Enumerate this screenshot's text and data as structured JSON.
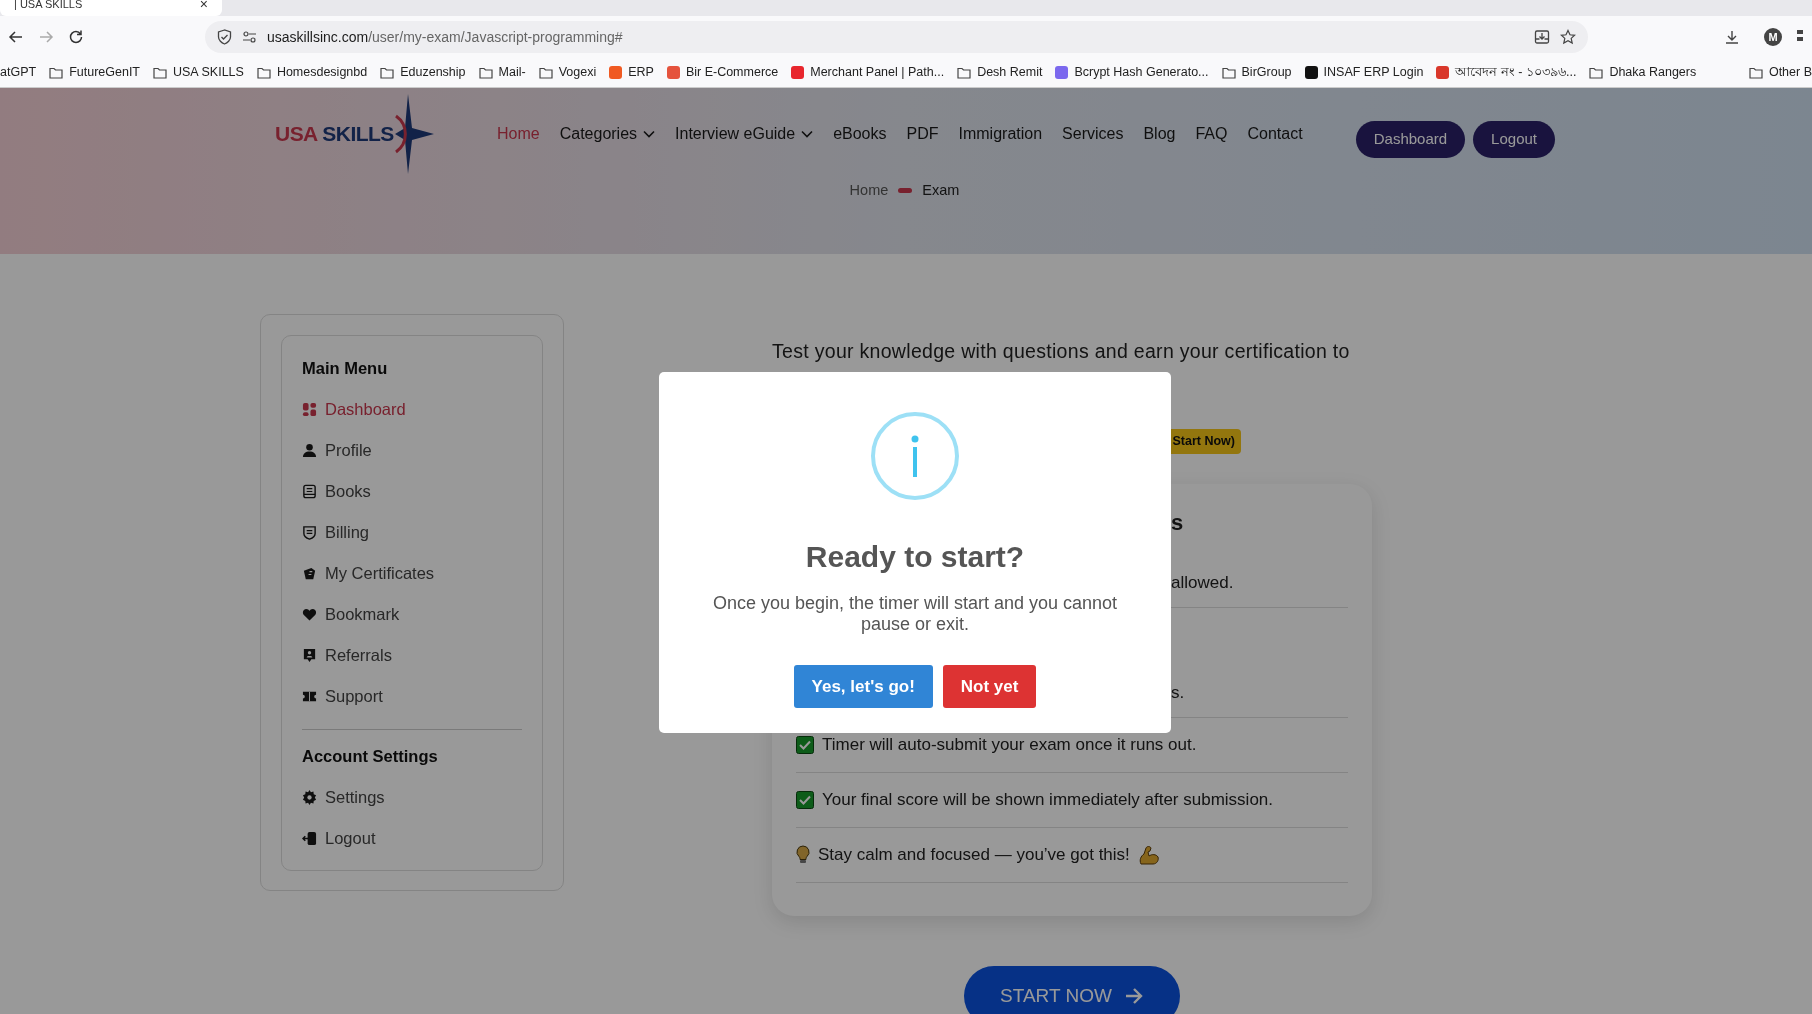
{
  "browser": {
    "tab": {
      "title": "| USA SKILLS",
      "close": "×"
    },
    "address": {
      "domain": "usaskillsinc.com",
      "path": "/user/my-exam/Javascript-programming#"
    },
    "profile": "M",
    "bookmarks": [
      {
        "label": "atGPT",
        "kind": "none"
      },
      {
        "label": "FutureGenIT",
        "kind": "folder"
      },
      {
        "label": "USA SKILLS",
        "kind": "folder"
      },
      {
        "label": "Homesdesignbd",
        "kind": "folder"
      },
      {
        "label": "Eduzenship",
        "kind": "folder"
      },
      {
        "label": "Mail-",
        "kind": "folder"
      },
      {
        "label": "Vogexi",
        "kind": "folder"
      },
      {
        "label": "ERP",
        "kind": "site",
        "color": "#f05a22"
      },
      {
        "label": "Bir E-Commerce",
        "kind": "site",
        "color": "#e5533d"
      },
      {
        "label": "Merchant Panel | Path...",
        "kind": "site",
        "color": "#e8262d"
      },
      {
        "label": "Desh Remit",
        "kind": "folder"
      },
      {
        "label": "Bcrypt Hash Generato...",
        "kind": "site",
        "color": "#7b68ee"
      },
      {
        "label": "BirGroup",
        "kind": "folder"
      },
      {
        "label": "INSAF ERP Login",
        "kind": "site",
        "color": "#111111"
      },
      {
        "label": "আবেদন নং - ১০৩৯৬...",
        "kind": "site",
        "color": "#d9372b"
      },
      {
        "label": "Dhaka Rangers",
        "kind": "folder"
      },
      {
        "label": "Other B",
        "kind": "folder"
      }
    ]
  },
  "header": {
    "logo": [
      "USA",
      "SKILLS"
    ],
    "nav": [
      {
        "label": "Home",
        "selected": true,
        "kind": "link"
      },
      {
        "label": "Categories",
        "selected": false,
        "kind": "dropdown"
      },
      {
        "label": "Interview eGuide",
        "selected": false,
        "kind": "dropdown"
      },
      {
        "label": "eBooks",
        "selected": false,
        "kind": "link"
      },
      {
        "label": "PDF",
        "selected": false,
        "kind": "link"
      },
      {
        "label": "Immigration",
        "selected": false,
        "kind": "link"
      },
      {
        "label": "Services",
        "selected": false,
        "kind": "link"
      },
      {
        "label": "Blog",
        "selected": false,
        "kind": "link"
      },
      {
        "label": "FAQ",
        "selected": false,
        "kind": "link"
      },
      {
        "label": "Contact",
        "selected": false,
        "kind": "link"
      }
    ],
    "buttons": [
      "Dashboard",
      "Logout"
    ],
    "breadcrumb": [
      "Home",
      "Exam"
    ]
  },
  "sidebar": {
    "sections": [
      {
        "title": "Main Menu",
        "items": [
          {
            "label": "Dashboard",
            "selected": true
          },
          {
            "label": "Profile",
            "selected": false
          },
          {
            "label": "Books",
            "selected": false
          },
          {
            "label": "Billing",
            "selected": false
          },
          {
            "label": "My Certificates",
            "selected": false
          },
          {
            "label": "Bookmark",
            "selected": false
          },
          {
            "label": "Referrals",
            "selected": false
          },
          {
            "label": "Support",
            "selected": false
          }
        ]
      },
      {
        "title": "Account Settings",
        "items": [
          {
            "label": "Settings",
            "selected": false
          },
          {
            "label": "Logout",
            "selected": false
          }
        ]
      }
    ]
  },
  "main": {
    "intro": "Test your knowledge with questions and earn your certification to",
    "badge": "Start Now)",
    "card": {
      "heading": "s",
      "rows": [
        {
          "text": "allowed.",
          "kind": "fragment"
        },
        {
          "text": "s.",
          "kind": "fragment"
        },
        {
          "text": "Timer will auto-submit your exam once it runs out.",
          "kind": "check"
        },
        {
          "text": "Your final score will be shown immediately after submission.",
          "kind": "check"
        },
        {
          "text": "Stay calm and focused — you’ve got this!",
          "kind": "tip"
        }
      ]
    },
    "start_button": "START NOW"
  },
  "dialog": {
    "title": "Ready to start?",
    "message": "Once you begin, the timer will start and you cannot pause or exit.",
    "buttons": [
      {
        "label": "Yes, let's go!",
        "kind": "confirm"
      },
      {
        "label": "Not yet",
        "kind": "cancel"
      }
    ]
  }
}
